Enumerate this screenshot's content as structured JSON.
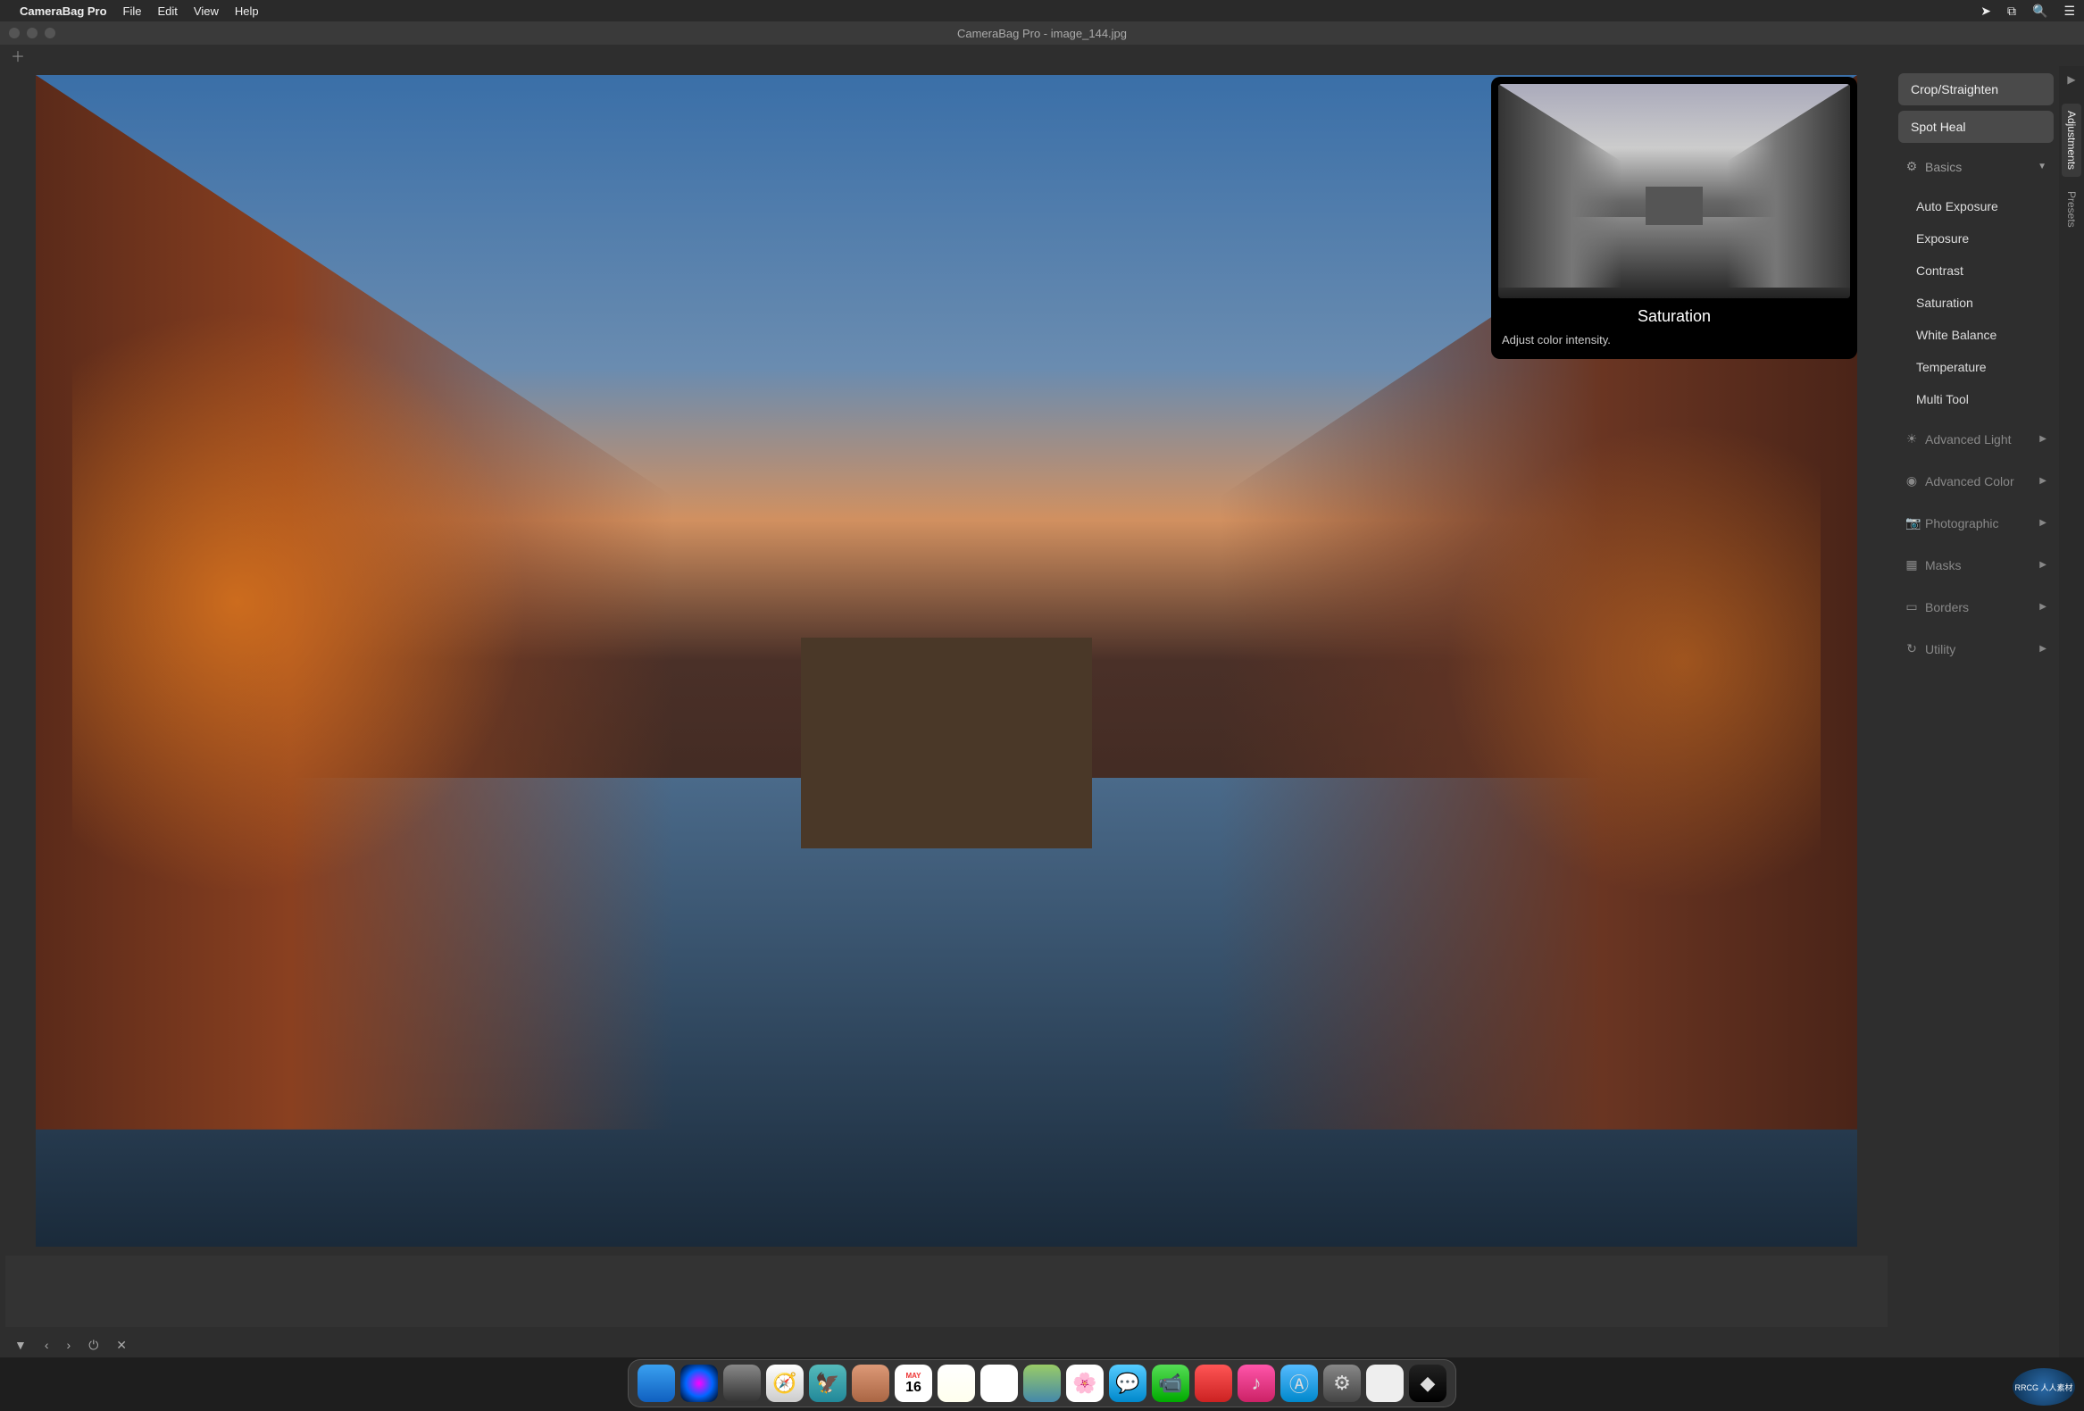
{
  "menubar": {
    "app_name": "CameraBag Pro",
    "items": [
      "File",
      "Edit",
      "View",
      "Help"
    ]
  },
  "window": {
    "title": "CameraBag Pro - image_144.jpg"
  },
  "popup": {
    "title": "Saturation",
    "description": "Adjust color intensity."
  },
  "sidebar": {
    "buttons": [
      "Crop/Straighten",
      "Spot Heal"
    ],
    "basics_label": "Basics",
    "basics_items": [
      "Auto Exposure",
      "Exposure",
      "Contrast",
      "Saturation",
      "White Balance",
      "Temperature",
      "Multi Tool"
    ],
    "sections": [
      {
        "icon": "☀",
        "label": "Advanced Light"
      },
      {
        "icon": "◉",
        "label": "Advanced Color"
      },
      {
        "icon": "📷",
        "label": "Photographic"
      },
      {
        "icon": "▦",
        "label": "Masks"
      },
      {
        "icon": "▭",
        "label": "Borders"
      },
      {
        "icon": "↻",
        "label": "Utility"
      }
    ]
  },
  "vtabs": {
    "adjustments": "Adjustments",
    "presets": "Presets"
  },
  "dock": {
    "calendar_month": "MAY",
    "calendar_day": "16"
  },
  "corner_logo": "RRCG\n人人素材"
}
